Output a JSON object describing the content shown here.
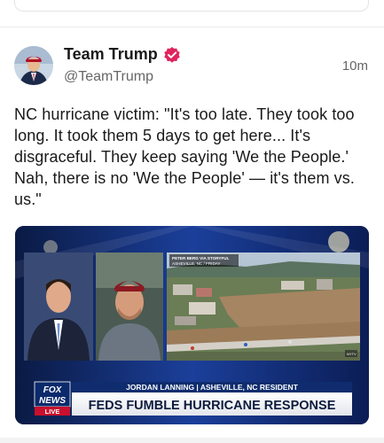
{
  "post": {
    "author_name": "Team Trump",
    "handle": "@TeamTrump",
    "time": "10m",
    "text": "NC hurricane victim: \"It's too late. They took too long. It took them 5 days to get here... It's disgraceful. They keep saying 'We the People.' Nah, there is no 'We the People' — it's them vs. us.\""
  },
  "media": {
    "credit_line1": "PETER BERG VIA STORYFUL",
    "credit_line2": "ASHEVILLE, NC / FRIDAY",
    "lower_third_name": "JORDAN LANNING | ASHEVILLE, NC RESIDENT",
    "headline": "FEDS FUMBLE HURRICANE RESPONSE",
    "logo_line1": "FOX",
    "logo_line2": "NEWS",
    "logo_line3": "LIVE",
    "corner_bug": "NYTV"
  },
  "icons": {
    "verified": "verified-badge-icon",
    "avatar": "avatar"
  },
  "colors": {
    "verified_badge": "#e0245e",
    "fox_blue": "#0b2a6b",
    "fox_red": "#c8102e"
  }
}
